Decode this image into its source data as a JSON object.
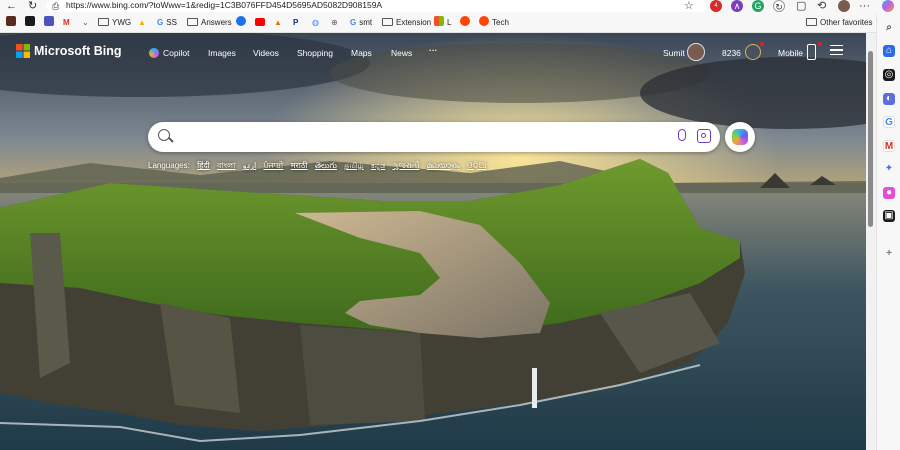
{
  "browser": {
    "url": "https://www.bing.com/?toWww=1&redig=1C3B076FFD454D5695AD5082D908159A",
    "profile_badge": "4",
    "favorites": [
      {
        "label": "",
        "icon": "app-icon-dark",
        "color": "#5b2a1e"
      },
      {
        "label": "",
        "icon": "word-app-icon",
        "color": "#1a1a1a"
      },
      {
        "label": "",
        "icon": "teams-icon",
        "color": "#4b53bc"
      },
      {
        "label": "",
        "icon": "gmail-icon",
        "color": "#d93025"
      },
      {
        "label": "",
        "icon": "chevron-icon",
        "color": "#888888"
      },
      {
        "label": "YWG",
        "icon": "folder-icon",
        "color": ""
      },
      {
        "label": "",
        "icon": "drive-icon",
        "color": "#f4b400"
      },
      {
        "label": "SS",
        "icon": "google-icon",
        "color": "#4285f4"
      },
      {
        "label": "Answers",
        "icon": "folder-icon",
        "color": ""
      },
      {
        "label": "",
        "icon": "info-icon",
        "color": "#1a73e8"
      },
      {
        "label": "",
        "icon": "youtube-icon",
        "color": "#ff0000"
      },
      {
        "label": "",
        "icon": "analytics-icon",
        "color": "#e37400"
      },
      {
        "label": "",
        "icon": "paypal-icon",
        "color": "#003087"
      },
      {
        "label": "",
        "icon": "translate-icon",
        "color": "#4285f4"
      },
      {
        "label": "",
        "icon": "globe-icon",
        "color": "#5f6368"
      },
      {
        "label": "smt",
        "icon": "google-icon",
        "color": "#4285f4"
      },
      {
        "label": "Extension",
        "icon": "folder-icon",
        "color": ""
      },
      {
        "label": "L",
        "icon": "microsoft-icon",
        "color": "#f25022"
      },
      {
        "label": "",
        "icon": "reddit-icon",
        "color": "#ff4500"
      },
      {
        "label": "Tech",
        "icon": "reddit-icon",
        "color": "#ff4500"
      }
    ],
    "other_favorites": "Other favorites"
  },
  "bing": {
    "logo": "Microsoft Bing",
    "nav": [
      "Copilot",
      "Images",
      "Videos",
      "Shopping",
      "Maps",
      "News"
    ],
    "more": "···",
    "user_name": "Sumit",
    "points": "8236",
    "mobile": "Mobile",
    "search_placeholder": "",
    "languages_label": "Languages:",
    "languages": [
      "हिंदी",
      "বাংলা",
      "اردو",
      "ਪੰਜਾਬੀ",
      "मराठी",
      "తెలుగు",
      "தமிழ்",
      "ಕನ್ನಡ",
      "ગુજરાતી",
      "മലയാളം",
      "ଓଡ଼ିଆ"
    ]
  },
  "colors": {
    "bing_orange": "#f25022",
    "accent": "#4a6cf7"
  }
}
